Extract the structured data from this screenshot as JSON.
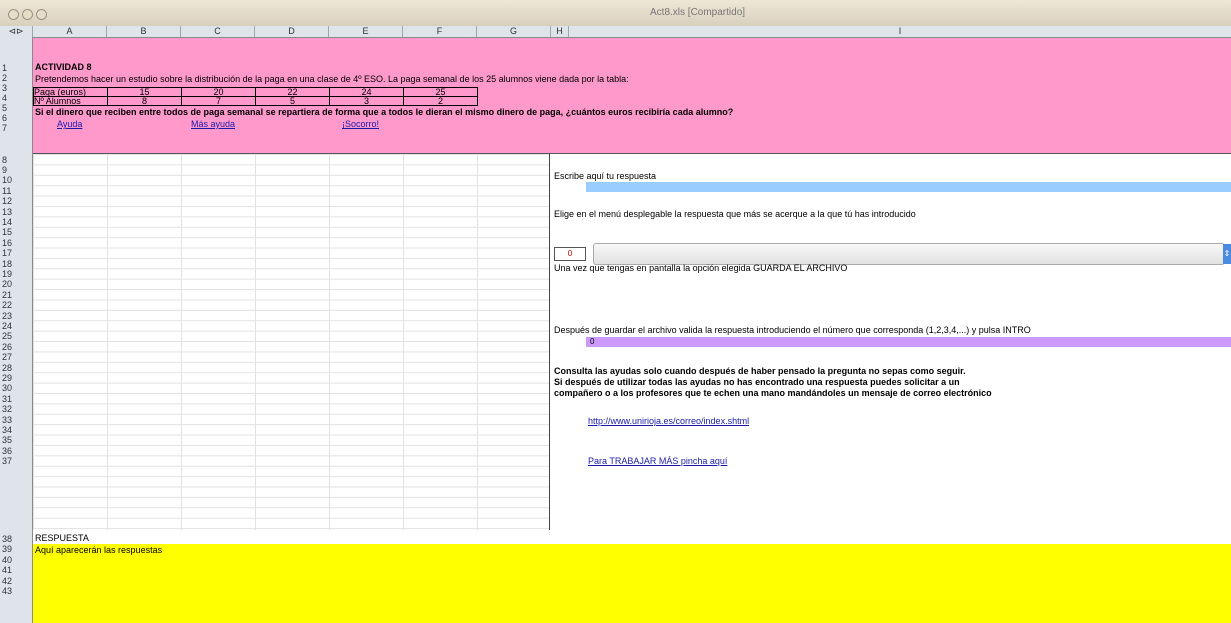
{
  "window": {
    "title": "Act8.xls  [Compartido]"
  },
  "columns": [
    "A",
    "B",
    "C",
    "D",
    "E",
    "F",
    "G",
    "H",
    "I"
  ],
  "rows": [
    "1",
    "2",
    "3",
    "4",
    "5",
    "6",
    "7",
    "8",
    "9",
    "10",
    "11",
    "12",
    "13",
    "14",
    "15",
    "16",
    "17",
    "18",
    "19",
    "20",
    "21",
    "22",
    "23",
    "24",
    "25",
    "26",
    "27",
    "28",
    "29",
    "30",
    "31",
    "32",
    "33",
    "34",
    "35",
    "36",
    "37",
    "38",
    "39",
    "40",
    "41",
    "42",
    "43"
  ],
  "activity": {
    "title": "ACTIVIDAD 8",
    "intro": "Pretendemos hacer un estudio sobre la distribución de la paga en una clase de 4º ESO. La paga semanal de los 25 alumnos viene dada por la tabla:",
    "table": [
      {
        "label": "Paga (euros)",
        "values": [
          "15",
          "20",
          "22",
          "24",
          "25"
        ]
      },
      {
        "label": "Nº Alumnos",
        "values": [
          "8",
          "7",
          "5",
          "3",
          "2"
        ]
      }
    ],
    "question": "Si el dinero que reciben entre todos de paga semanal se repartiera de forma que a todos le dieran el mismo dinero de paga, ¿cuántos euros recibiría cada alumno?",
    "links": {
      "help": "Ayuda",
      "more_help": "Más ayuda",
      "sos": "¡Socorro!"
    }
  },
  "answer_panel": {
    "write_label": "Escribe aquí tu respuesta",
    "choose_label": "Elige en el menú desplegable la respuesta que más se acerque a la que tú has introducido",
    "dropdown_number": "0",
    "save_label": "Una vez que tengas en pantalla la opción elegida GUARDA EL ARCHIVO",
    "validate_label": "Después de guardar el archivo valida la respuesta introduciendo el número que corresponda (1,2,3,4,...) y pulsa INTRO",
    "validate_value": "0",
    "advice_1": "Consulta las ayudas solo cuando después de haber pensado la pregunta no sepas como seguir.",
    "advice_2": "Si después de utilizar todas las ayudas no has encontrado una respuesta puedes solicitar a un",
    "advice_3": "compañero o a los profesores que te echen una mano mandándoles un mensaje de correo electrónico",
    "email_link": "http://www.unirioja.es/correo/index.shtml",
    "more_work_link": "Para TRABAJAR MÁS pincha aquí"
  },
  "response": {
    "header": "RESPUESTA",
    "text": "Aquí aparecerán las respuestas"
  },
  "colors": {
    "pink": "#ff99cc",
    "yellow": "#ffff00",
    "input_blue": "#99ccff",
    "input_purple": "#cc99ff"
  }
}
